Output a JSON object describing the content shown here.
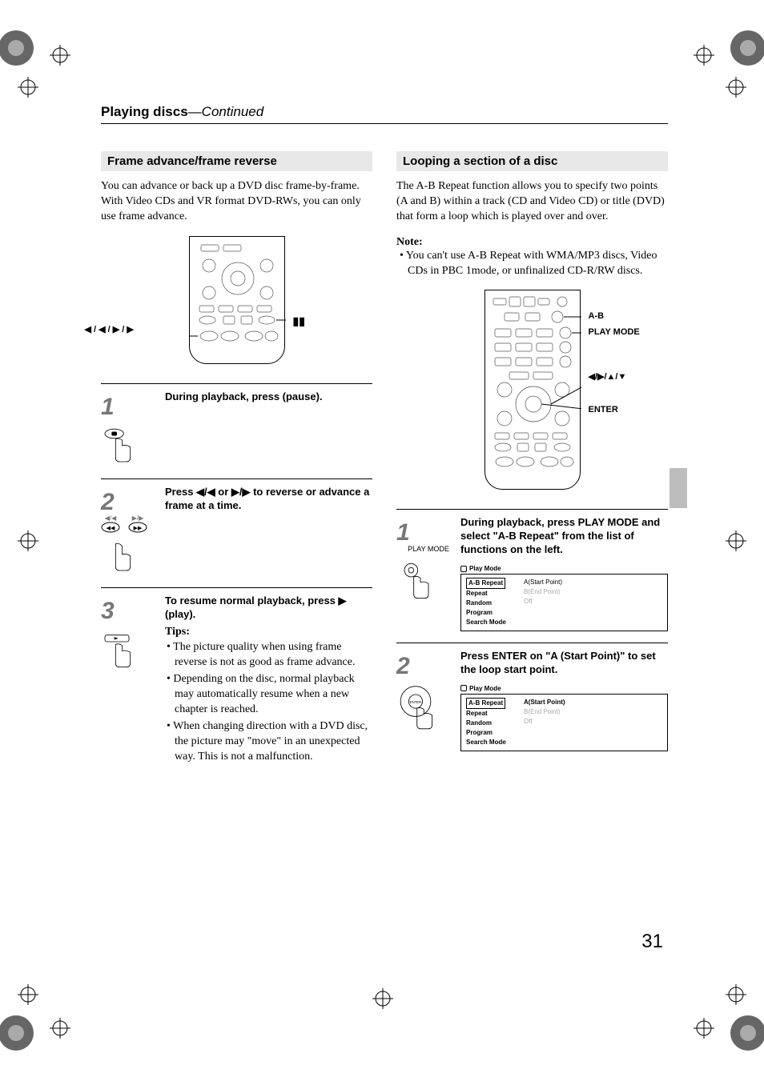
{
  "header": {
    "title": "Playing discs",
    "continued": "—Continued"
  },
  "page_number": "31",
  "left_col": {
    "heading": "Frame advance/frame reverse",
    "intro": "You can advance or back up a DVD disc frame-by-frame. With Video CDs and VR format DVD-RWs, you can only use frame advance.",
    "remote_callout_left": "◀ / ◀ / ▶ / ▶",
    "remote_callout_right": "",
    "step1": {
      "num": "1",
      "text": "During playback, press  (pause)."
    },
    "step2": {
      "num": "2",
      "text": "Press ◀/◀ or ▶/▶ to reverse or advance a frame at a time.",
      "icon_top_left": "◀/◀",
      "icon_top_right": "▶/▶"
    },
    "step3": {
      "num": "3",
      "text": "To resume normal playback, press ▶ (play).",
      "tips_label": "Tips:",
      "tips": [
        "The picture quality when using frame reverse is not as good as frame advance.",
        "Depending on the disc, normal playback may automatically resume when a new chapter is reached.",
        "When changing direction with a DVD disc, the picture may \"move\" in an unexpected way. This is not a malfunction."
      ]
    }
  },
  "right_col": {
    "heading": "Looping a section of a disc",
    "intro": "The A-B Repeat function allows you to specify two points (A and B) within a track (CD and Video CD) or title (DVD) that form a loop which is played over and over.",
    "note_label": "Note:",
    "note_bullet": "You can't use A-B Repeat with WMA/MP3 discs, Video CDs in PBC 1mode, or unfinalized CD-R/RW discs.",
    "remote_labels": {
      "ab": "A-B",
      "playmode": "PLAY MODE",
      "nav": "◀/▶/▲/▼",
      "enter": "ENTER"
    },
    "step1": {
      "num": "1",
      "icon_label": "PLAY MODE",
      "text": "During playback, press PLAY MODE and select \"A-B Repeat\" from the list of functions on the left.",
      "osd_title": "Play Mode",
      "osd_left": [
        "A-B Repeat",
        "Repeat",
        "Random",
        "Program",
        "Search Mode"
      ],
      "osd_right": [
        "A(Start Point)",
        "B(End Point)",
        "Off"
      ]
    },
    "step2": {
      "num": "2",
      "text": "Press ENTER on \"A (Start Point)\" to set the loop start point.",
      "osd_title": "Play Mode",
      "osd_left": [
        "A-B Repeat",
        "Repeat",
        "Random",
        "Program",
        "Search Mode"
      ],
      "osd_right": [
        "A(Start Point)",
        "B(End Point)",
        "Off"
      ]
    }
  }
}
